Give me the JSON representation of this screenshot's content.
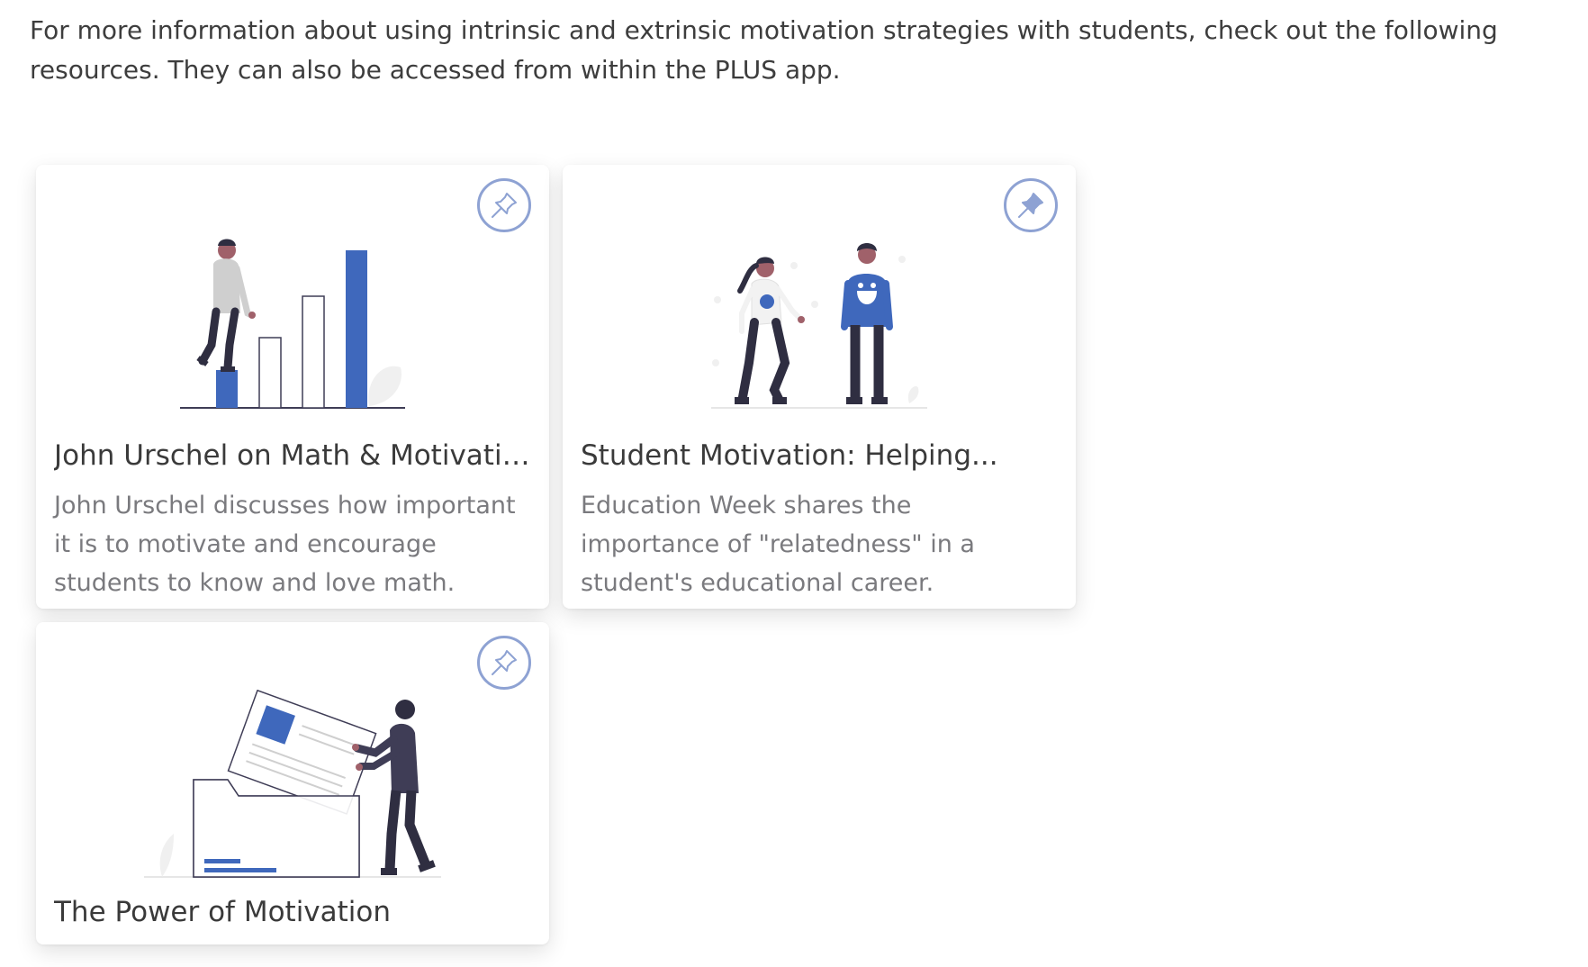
{
  "intro": {
    "text": "For more information about using intrinsic and extrinsic motivation strategies with students, check out the following resources. They can also be accessed from within the PLUS app."
  },
  "colors": {
    "accent": "#3f68bc",
    "pin_border": "#8ea2d3",
    "title_text": "#3a3a3a",
    "desc_text": "#7a7a7e"
  },
  "cards": [
    {
      "title": "John Urschel on Math & Motivation",
      "description": "John Urschel discusses how important it is to motivate and encourage students to know and love math.",
      "pin_icon": "pin-outline-icon",
      "pinned": false,
      "illustration": "bar-chart-climber-illustration"
    },
    {
      "title": "Student Motivation: Helping...",
      "description": "Education Week shares the importance of \"relatedness\" in a student's educational career.",
      "pin_icon": "pin-filled-icon",
      "pinned": true,
      "illustration": "two-students-illustration"
    },
    {
      "title": "The Power of Motivation",
      "description": "",
      "pin_icon": "pin-outline-icon",
      "pinned": false,
      "illustration": "document-folder-illustration"
    }
  ]
}
